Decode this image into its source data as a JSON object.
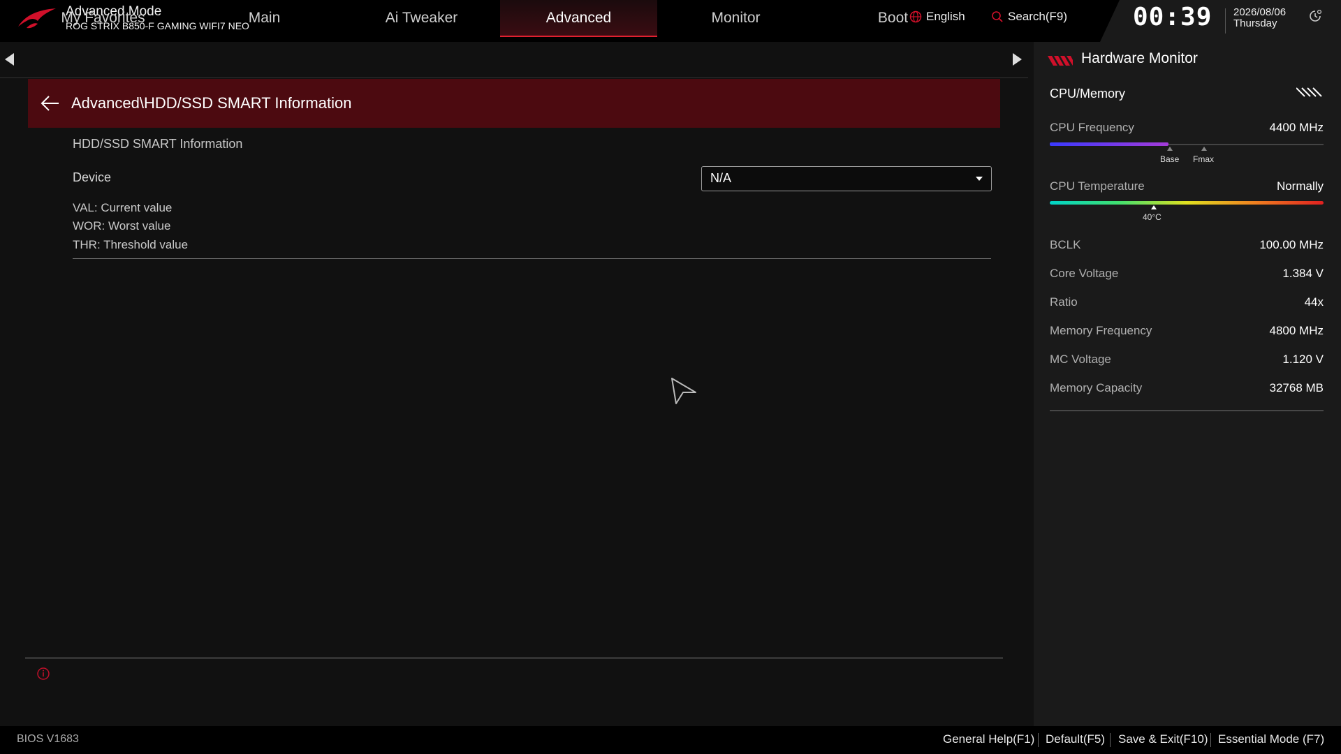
{
  "header": {
    "mode_title": "Advanced Mode",
    "board_name": "ROG STRIX B850-F GAMING WIFI7 NEO",
    "language": "English",
    "search": "Search(F9)",
    "time": "00:39",
    "date": "2026/08/06",
    "weekday": "Thursday"
  },
  "tabs": [
    "My Favorites",
    "Main",
    "Ai Tweaker",
    "Advanced",
    "Monitor",
    "Boot"
  ],
  "active_tab": "Advanced",
  "breadcrumb": "Advanced\\HDD/SSD SMART Information",
  "content": {
    "section_title": "HDD/SSD SMART Information",
    "device_label": "Device",
    "device_value": "N/A",
    "legend": [
      "VAL:  Current value",
      "WOR: Worst value",
      "THR:  Threshold value"
    ]
  },
  "hardware_monitor": {
    "title": "Hardware Monitor",
    "section": "CPU/Memory",
    "cpu_frequency": {
      "label": "CPU Frequency",
      "value": "4400 MHz",
      "base_label": "Base",
      "fmax_label": "Fmax"
    },
    "cpu_temperature": {
      "label": "CPU Temperature",
      "value": "Normally",
      "marker_label": "40°C"
    },
    "rows": [
      {
        "label": "BCLK",
        "value": "100.00 MHz"
      },
      {
        "label": "Core Voltage",
        "value": "1.384 V"
      },
      {
        "label": "Ratio",
        "value": "44x"
      },
      {
        "label": "Memory Frequency",
        "value": "4800 MHz"
      },
      {
        "label": "MC Voltage",
        "value": "1.120 V"
      },
      {
        "label": "Memory Capacity",
        "value": "32768 MB"
      }
    ]
  },
  "footer": {
    "bios_version": "BIOS V1683",
    "general_help": "General Help(F1)",
    "default": "Default(F5)",
    "save_exit": "Save & Exit(F10)",
    "essential_mode": "Essential Mode (F7)"
  },
  "colors": {
    "accent": "#e02030",
    "breadcrumb_bg": "#4c0a10",
    "panel_bg": "#1a1a1a"
  }
}
